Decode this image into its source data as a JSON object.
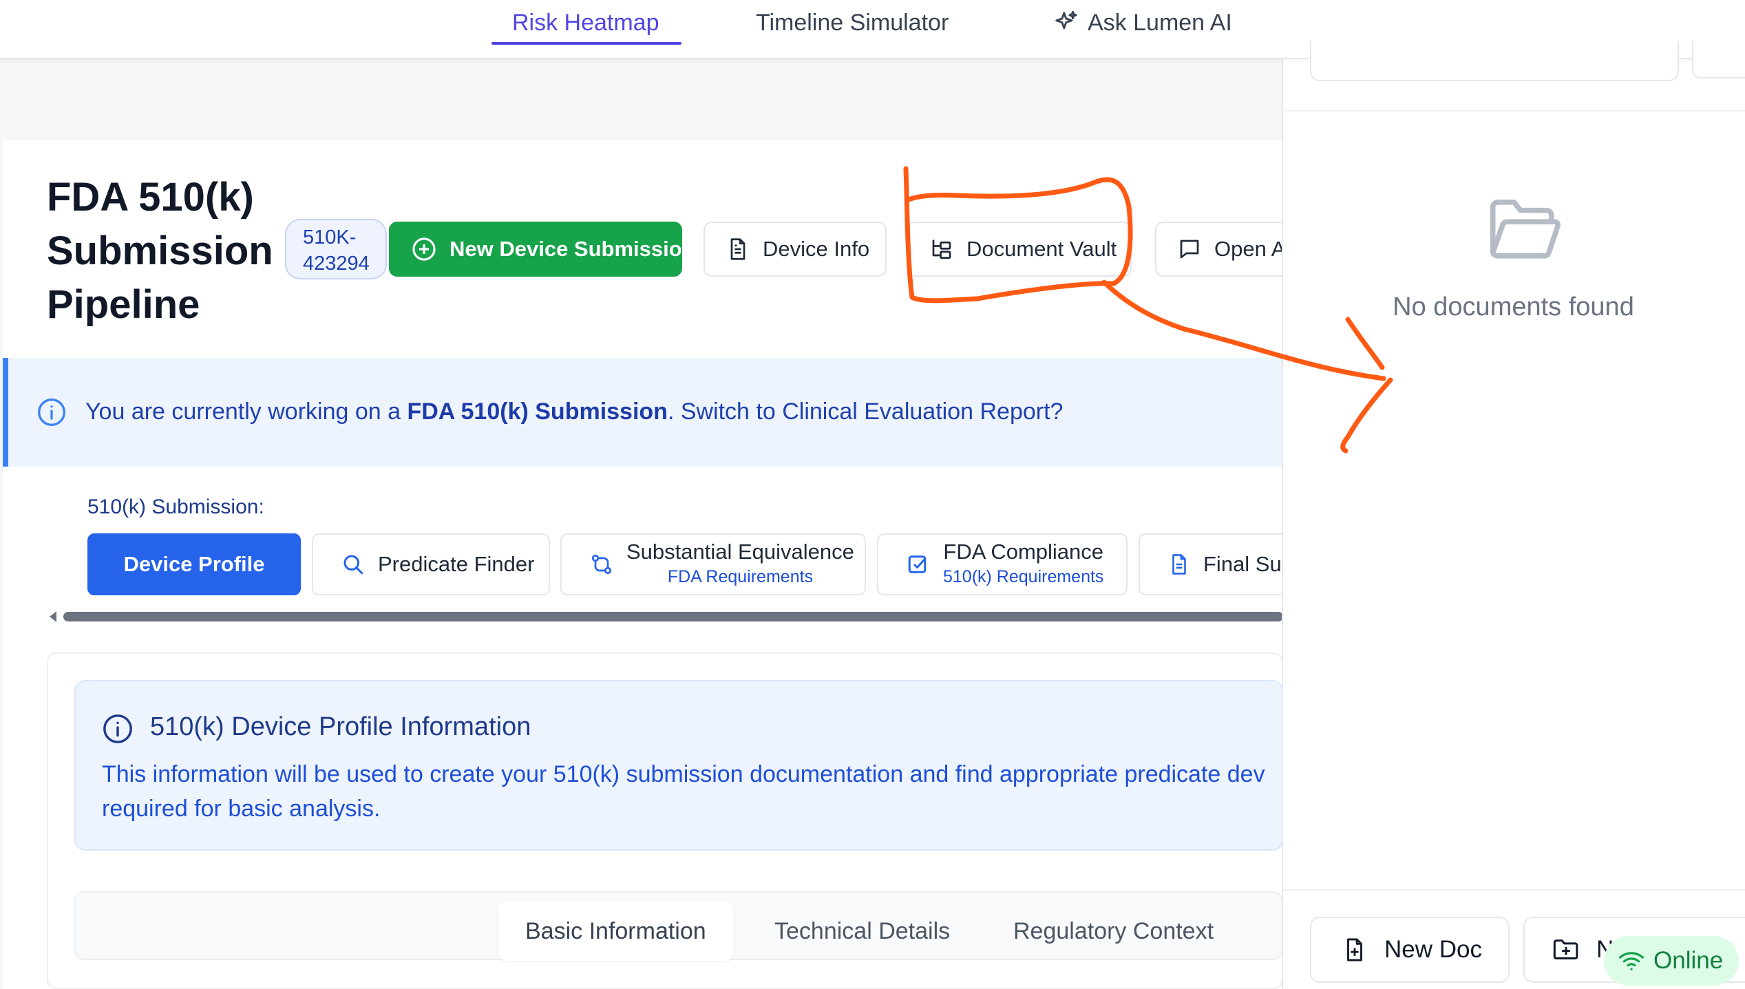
{
  "nav": {
    "tabs": [
      {
        "label": "Risk Heatmap"
      },
      {
        "label": "Timeline Simulator"
      },
      {
        "label": "Ask Lumen AI"
      }
    ]
  },
  "header": {
    "title": "FDA 510(k) Submission Pipeline",
    "badge": "510K-423294",
    "buttons": {
      "new_submission": "New Device Submission",
      "device_info": "Device Info",
      "document_vault": "Document Vault",
      "open": "Open A"
    }
  },
  "alert": {
    "prefix": "You are currently working on a ",
    "highlight": "FDA 510(k) Submission",
    "suffix": ". Switch to Clinical Evaluation Report?"
  },
  "steps": {
    "label": "510(k) Submission:",
    "items": [
      {
        "title": "Device Profile",
        "subtitle": ""
      },
      {
        "title": "Predicate Finder",
        "subtitle": ""
      },
      {
        "title": "Substantial Equivalence",
        "subtitle": "FDA Requirements"
      },
      {
        "title": "FDA Compliance",
        "subtitle": "510(k) Requirements"
      },
      {
        "title": "Final Sub",
        "subtitle": ""
      }
    ]
  },
  "info": {
    "title": "510(k) Device Profile Information",
    "body": "This information will be used to create your 510(k) submission documentation and find appropriate predicate dev required for basic analysis."
  },
  "subtabs": [
    "Basic Information",
    "Technical Details",
    "Regulatory Context"
  ],
  "side_panel": {
    "empty_text": "No documents found",
    "new_doc": "New Doc",
    "second_btn": "N",
    "status": "Online"
  },
  "colors": {
    "accent": "#5145e5",
    "primary_green": "#16a34a",
    "primary_blue": "#2563eb",
    "annotation": "#ff5a14"
  }
}
